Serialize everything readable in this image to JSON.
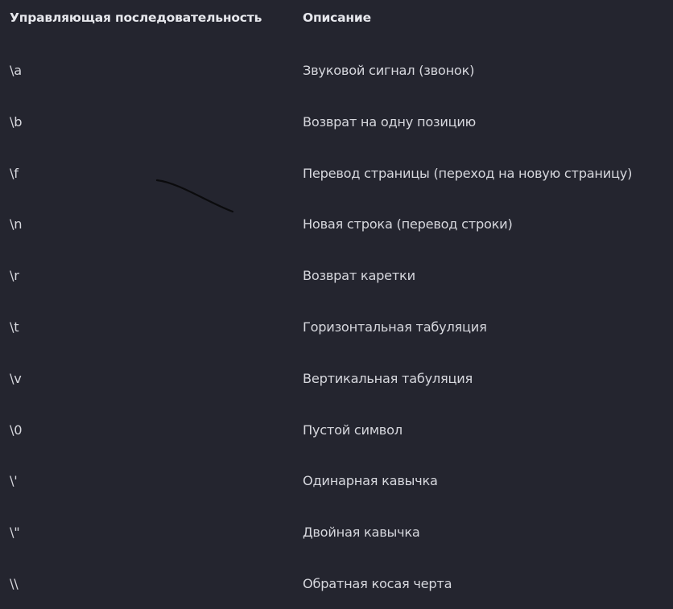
{
  "header": {
    "col_sequence": "Управляющая последовательность",
    "col_description": "Описание"
  },
  "rows": [
    {
      "sequence": "\\a",
      "description": "Звуковой сигнал (звонок)"
    },
    {
      "sequence": "\\b",
      "description": "Возврат на одну позицию"
    },
    {
      "sequence": "\\f",
      "description": "Перевод страницы (переход на новую страницу)"
    },
    {
      "sequence": "\\n",
      "description": "Новая строка (перевод строки)"
    },
    {
      "sequence": "\\r",
      "description": "Возврат каретки"
    },
    {
      "sequence": "\\t",
      "description": "Горизонтальная табуляция"
    },
    {
      "sequence": "\\v",
      "description": "Вертикальная табуляция"
    },
    {
      "sequence": "\\0",
      "description": "Пустой символ"
    },
    {
      "sequence": "\\'",
      "description": "Одинарная кавычка"
    },
    {
      "sequence": "\\\"",
      "description": "Двойная кавычка"
    },
    {
      "sequence": "\\\\",
      "description": "Обратная косая черта"
    }
  ],
  "colors": {
    "background": "#24252f",
    "text": "#d6d7dd",
    "header_text": "#e6e7ec",
    "pen_stroke": "#0b0b0d"
  }
}
